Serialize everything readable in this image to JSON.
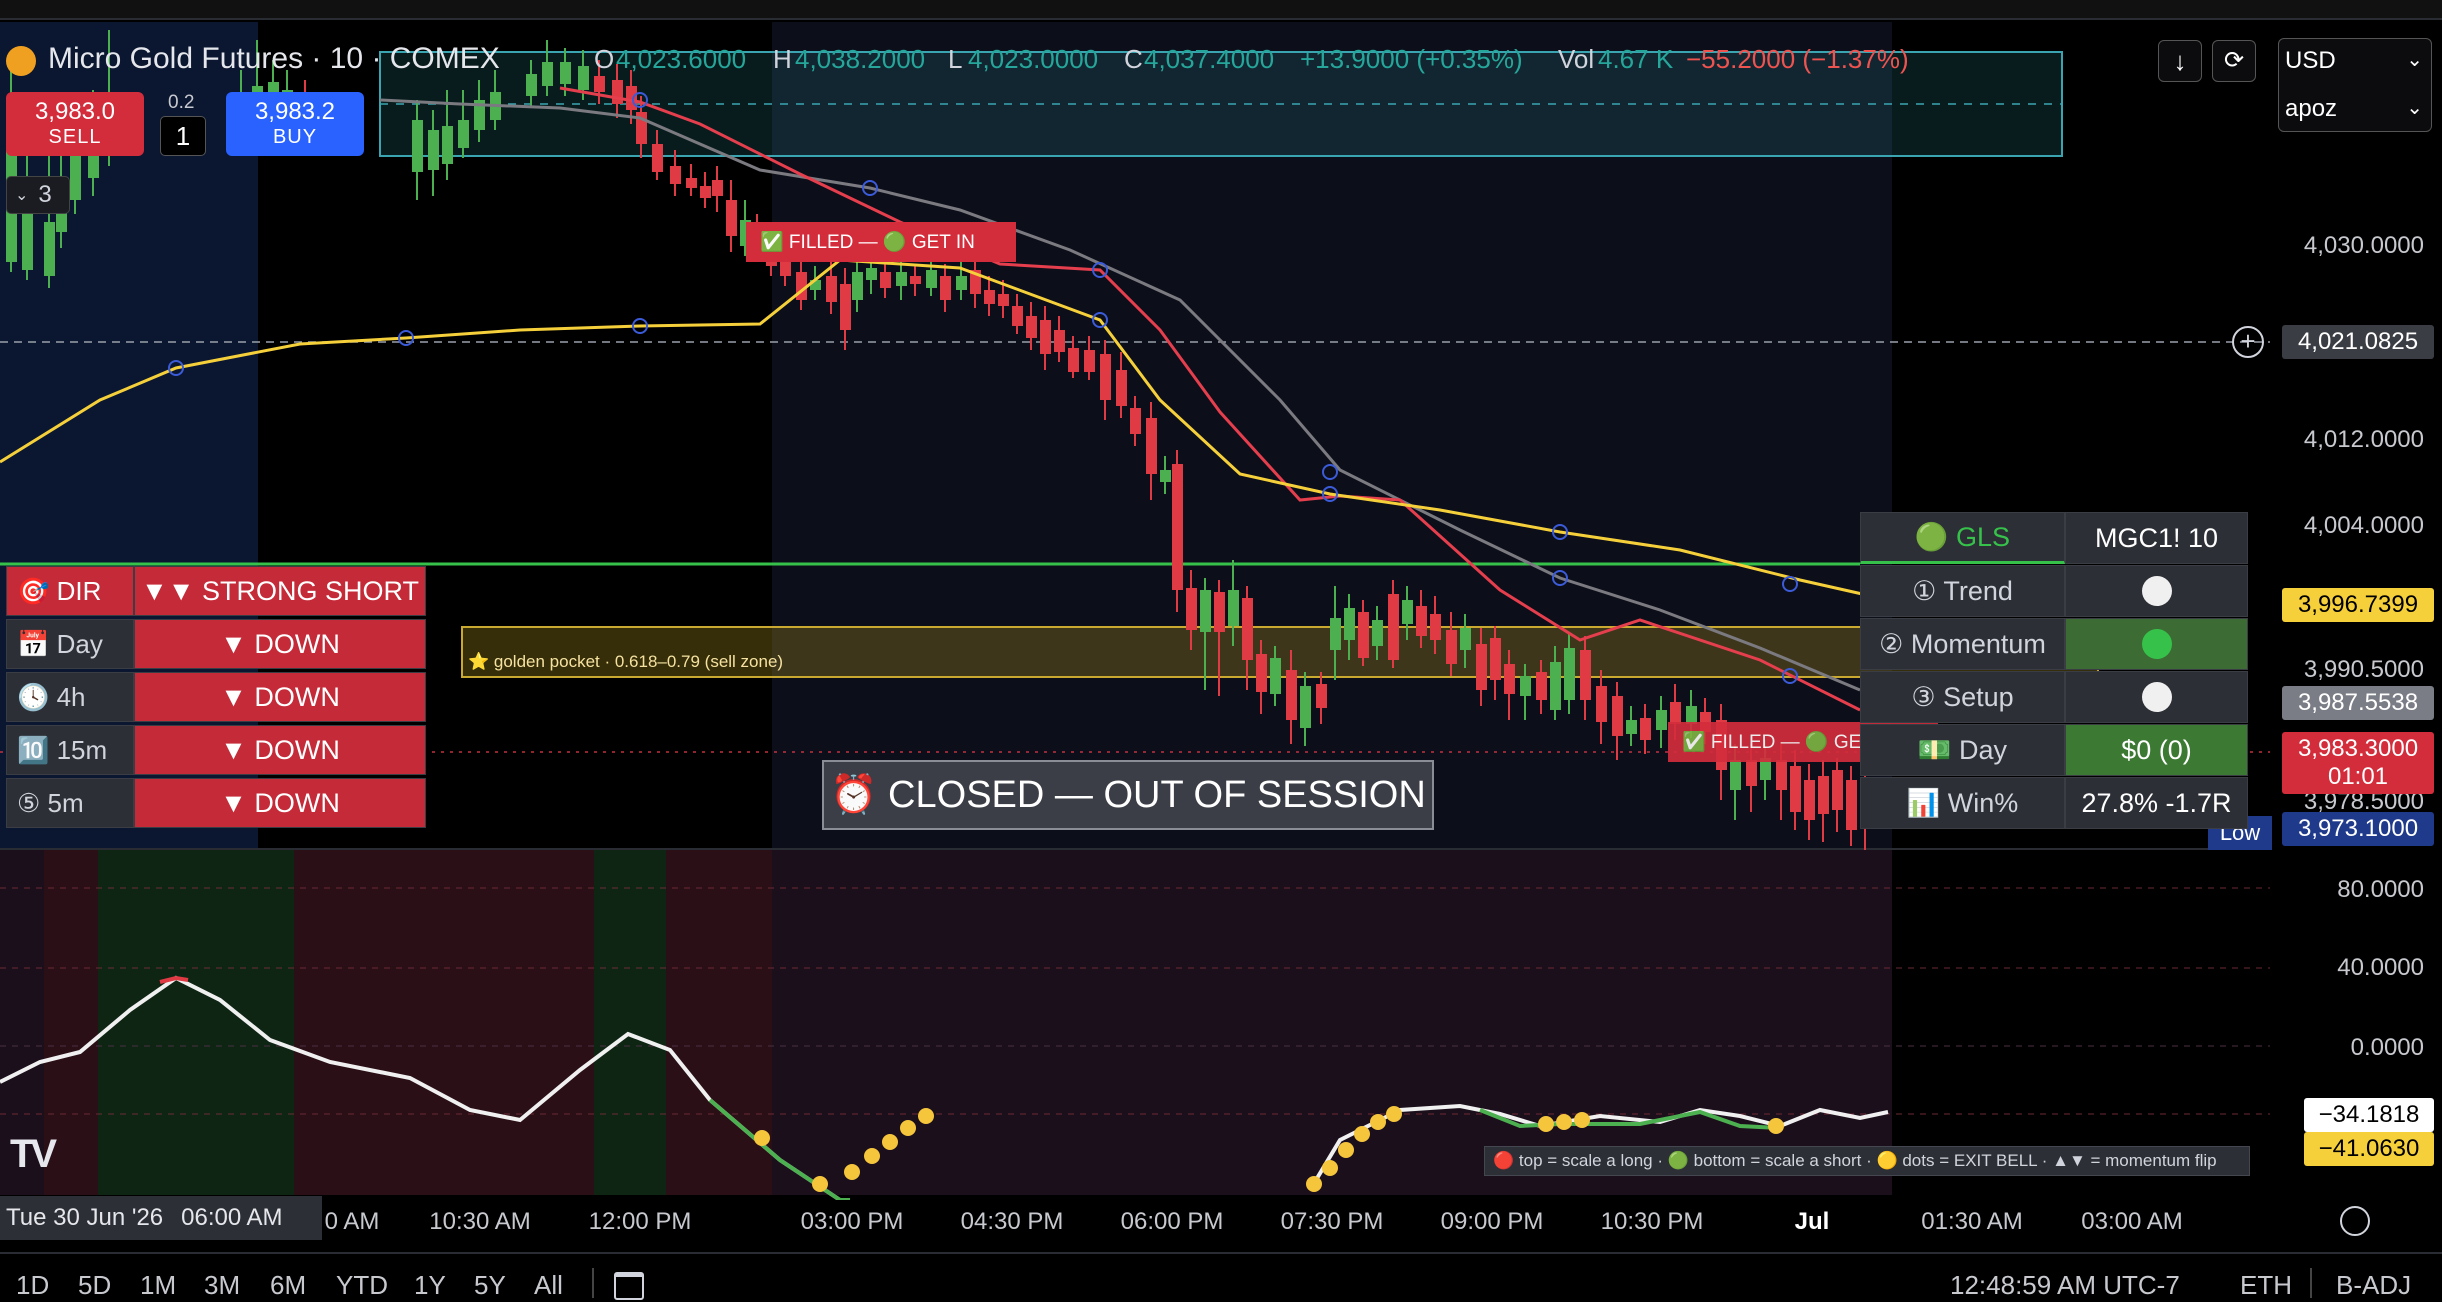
{
  "colors": {
    "up": "#4caf50",
    "down": "#e03a44",
    "ema_red": "#e53e4d",
    "ema_yellow": "#f5d03b",
    "ema_grey": "#777",
    "accent_green": "#36c24a"
  },
  "header": {
    "symbol": "Micro Gold Futures · 10 · COMEX",
    "o_key": "O",
    "o_val": "4,023.6000",
    "h_key": "H",
    "h_val": "4,038.2000",
    "l_key": "L",
    "l_val": "4,023.0000",
    "c_key": "C",
    "c_val": "4,037.4000",
    "change": "+13.9000 (+0.35%)",
    "vol_key": "Vol",
    "vol_val": "4.67 K",
    "vol_change": "−55.2000 (−1.37%)"
  },
  "trade": {
    "sell_price": "3,983.0",
    "sell_label": "SELL",
    "spread": "0.2",
    "qty": "1",
    "buy_price": "3,983.2",
    "buy_label": "BUY",
    "collapse_count": "3"
  },
  "top_right": {
    "currency": "USD",
    "account": "apoz"
  },
  "y_axis": {
    "ticks": [
      "4,030.0000",
      "4,012.0000",
      "4,004.0000",
      "3,990.5000",
      "3,978.5000"
    ],
    "sub_ticks": [
      "80.0000",
      "40.0000",
      "0.0000"
    ],
    "crosshair_price": "4,021.0825",
    "tag_yellow": "3,996.7399",
    "tag_grey": "3,987.5538",
    "tag_red_price": "3,983.3000",
    "tag_red_timer": "01:01",
    "low_label": "Low",
    "low_price": "3,973.1000",
    "osc_value_white": "−34.1818",
    "osc_value_yellow": "−41.0630"
  },
  "x_axis": {
    "labels": [
      "10:30 AM",
      "12:00 PM",
      "03:00 PM",
      "04:30 PM",
      "06:00 PM",
      "07:30 PM",
      "09:00 PM",
      "10:30 PM",
      "Jul",
      "01:30 AM",
      "03:00 AM"
    ],
    "partial": "0 AM",
    "cursor_date": "Tue 30 Jun '26",
    "cursor_time": "06:00 AM"
  },
  "annotations": {
    "filled_1": "✅ FILLED — 🟢 GET IN",
    "filled_2": "✅ FILLED — 🟢 GET IN",
    "golden_pocket": "⭐ golden pocket · 0.618–0.79 (sell zone)",
    "session": "⏰ CLOSED — OUT OF SESSION",
    "legend": "🔴 top = scale a long · 🟢 bottom = scale a short · 🟡 dots = EXIT BELL · ▲▼ = momentum flip"
  },
  "dir_table": {
    "header_key": "🎯 DIR",
    "header_val": "▼▼ STRONG SHORT",
    "rows": [
      {
        "key": "📅 Day",
        "val": "▼ DOWN"
      },
      {
        "key": "🕓 4h",
        "val": "▼ DOWN"
      },
      {
        "key": "🔟 15m",
        "val": "▼ DOWN"
      },
      {
        "key": "⑤ 5m",
        "val": "▼ DOWN"
      }
    ]
  },
  "gls_table": {
    "header_key": "🟢 GLS",
    "header_val": "MGC1! 10",
    "rows": [
      {
        "key": "① Trend",
        "state": "white"
      },
      {
        "key": "② Momentum",
        "state": "green"
      },
      {
        "key": "③ Setup",
        "state": "white"
      },
      {
        "key": "💵 Day",
        "val": "$0 (0)"
      },
      {
        "key": "📊 Win%",
        "val": "27.8%  -1.7R"
      }
    ]
  },
  "bottom_bar": {
    "timeframes": [
      "1D",
      "5D",
      "1M",
      "3M",
      "6M",
      "YTD",
      "1Y",
      "5Y",
      "All"
    ],
    "clock": "12:48:59 AM UTC-7",
    "session": "ETH",
    "adjust": "B-ADJ"
  },
  "logo_text": "TV"
}
